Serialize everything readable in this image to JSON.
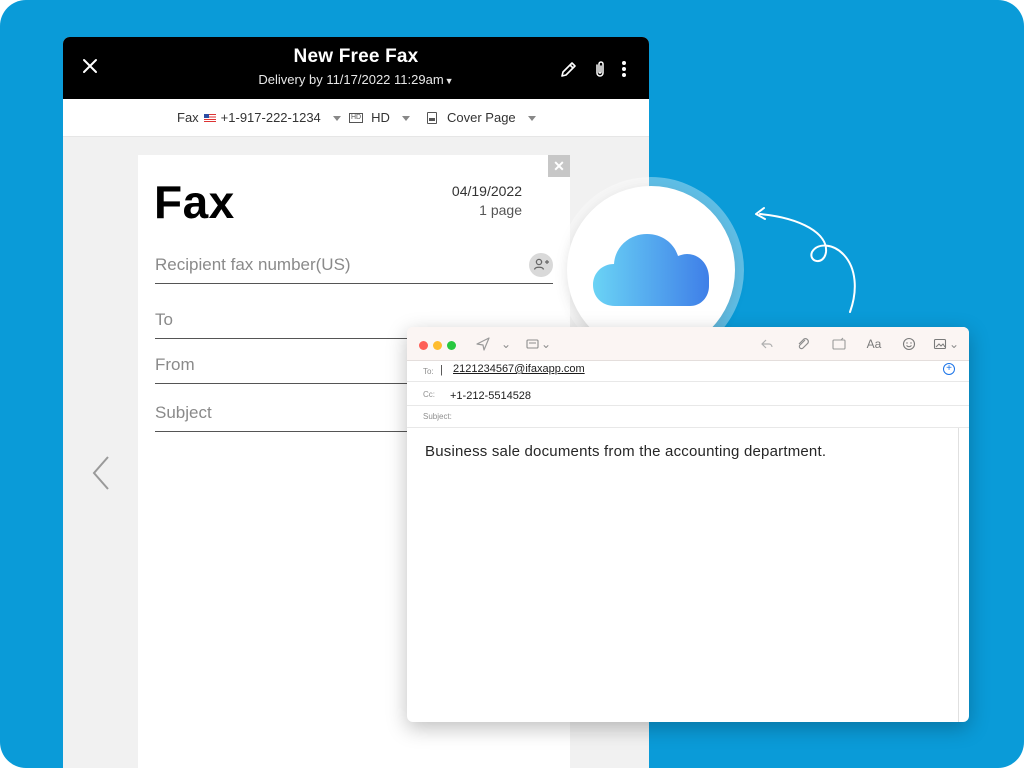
{
  "fax_app": {
    "header": {
      "title": "New Free Fax",
      "subtitle": "Delivery by 11/17/2022 11:29am"
    },
    "toolbar": {
      "fax_label": "Fax",
      "fax_number": "+1-917-222-1234",
      "quality_icon_text": "HD",
      "quality_label": "HD",
      "cover_page_label": "Cover Page"
    },
    "cover_sheet": {
      "title": "Fax",
      "date": "04/19/2022",
      "pages": "1 page",
      "recipient_placeholder": "Recipient fax number(US)",
      "to_placeholder": "To",
      "from_placeholder": "From",
      "subject_placeholder": "Subject"
    },
    "icons": {
      "close": "close-icon",
      "edit": "pencil-icon",
      "attach": "paperclip-icon",
      "more": "more-vertical-icon",
      "prev": "chevron-left-icon",
      "contacts": "add-contact-icon",
      "cloud": "icloud-icon"
    }
  },
  "mail_window": {
    "to_label": "To:",
    "to_value": "2121234567@ifaxapp.com",
    "cc_label": "Cc:",
    "cc_value": "+1-212-5514528",
    "subject_label": "Subject:",
    "subject_value": "",
    "body": "Business sale documents from the accounting department."
  },
  "colors": {
    "background": "#0a9bd8",
    "header": "#000000",
    "cloud_light": "#6ad3f5",
    "cloud_dark": "#3f7fe8",
    "mail_link": "#1a73e8"
  }
}
